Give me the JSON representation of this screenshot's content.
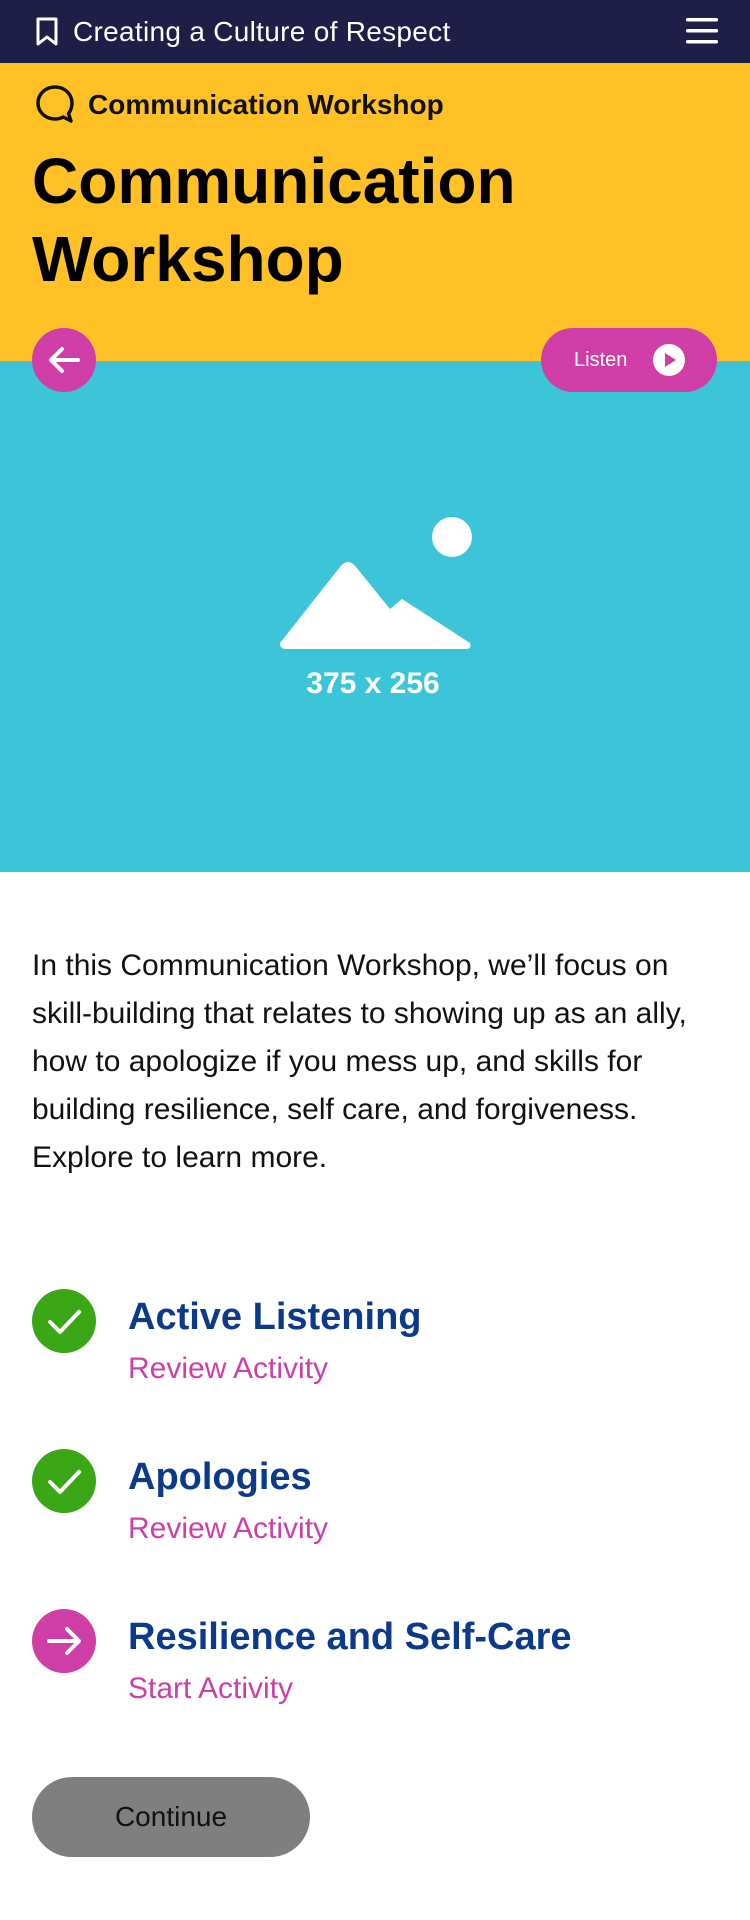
{
  "topbar": {
    "title": "Creating a Culture of Respect",
    "bookmark_icon": "bookmark-icon",
    "menu_icon": "hamburger-menu-icon"
  },
  "header": {
    "section_icon": "speech-bubble-icon",
    "section_label": "Communication Workshop",
    "title": "Communication Workshop"
  },
  "controls": {
    "back_icon": "arrow-left-icon",
    "listen_label": "Listen",
    "listen_icon": "play-icon"
  },
  "hero": {
    "placeholder_icon": "image-placeholder-icon",
    "size_label": "375 x 256"
  },
  "intro": "In this Communication Workshop, we’ll focus on skill-building that relates to showing up as an ally, how to apologize if you mess up, and skills for building resilience, self care, and forgiveness. Explore to learn more.",
  "activities": [
    {
      "title": "Active Listening",
      "action": "Review Activity",
      "status": "completed",
      "icon": "checkmark-icon"
    },
    {
      "title": "Apologies",
      "action": "Review Activity",
      "status": "completed",
      "icon": "checkmark-icon"
    },
    {
      "title": "Resilience and Self-Care",
      "action": "Start Activity",
      "status": "next",
      "icon": "arrow-right-icon"
    }
  ],
  "continue_label": "Continue",
  "colors": {
    "topbar": "#1f1e47",
    "header": "#ffc125",
    "hero": "#3cc5d8",
    "accent": "#cf3ea6",
    "completed": "#3aa515",
    "activity_title": "#0b3a8a",
    "continue_button": "#7f7f7f"
  }
}
